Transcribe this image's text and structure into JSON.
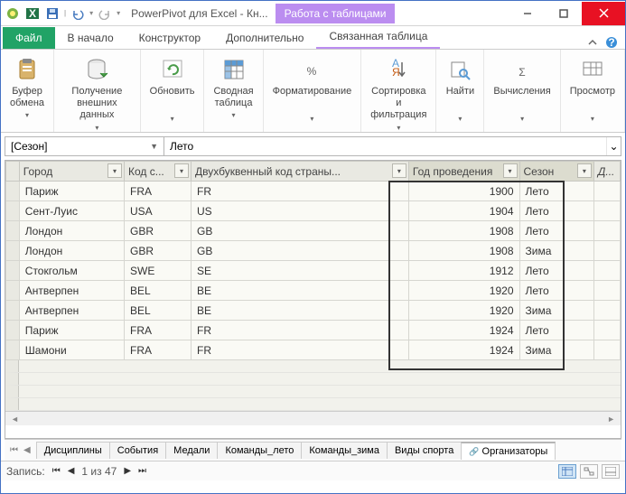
{
  "titlebar": {
    "app_title": "PowerPivot для Excel - Кн...",
    "context_tab": "Работа с таблицами"
  },
  "tabs": {
    "file": "Файл",
    "home": "В начало",
    "design": "Конструктор",
    "advanced": "Дополнительно",
    "linked": "Связанная таблица"
  },
  "ribbon": {
    "clipboard": "Буфер\nобмена",
    "getdata": "Получение\nвнешних данных",
    "refresh": "Обновить",
    "pivot": "Сводная\nтаблица",
    "format": "Форматирование",
    "sort": "Сортировка и\nфильтрация",
    "find": "Найти",
    "calc": "Вычисления",
    "view": "Просмотр"
  },
  "formula_bar": {
    "name": "[Сезон]",
    "value": "Лето"
  },
  "columns": {
    "city": "Город",
    "code_c": "Код с...",
    "two_letter": "Двухбуквенный код страны...",
    "year": "Год проведения",
    "season": "Сезон",
    "add": "Д..."
  },
  "rows": [
    {
      "city": "Париж",
      "code": "FRA",
      "cc": "FR",
      "year": "1900",
      "season": "Лето"
    },
    {
      "city": "Сент-Луис",
      "code": "USA",
      "cc": "US",
      "year": "1904",
      "season": "Лето"
    },
    {
      "city": "Лондон",
      "code": "GBR",
      "cc": "GB",
      "year": "1908",
      "season": "Лето"
    },
    {
      "city": "Лондон",
      "code": "GBR",
      "cc": "GB",
      "year": "1908",
      "season": "Зима"
    },
    {
      "city": "Стокгольм",
      "code": "SWE",
      "cc": "SE",
      "year": "1912",
      "season": "Лето"
    },
    {
      "city": "Антверпен",
      "code": "BEL",
      "cc": "BE",
      "year": "1920",
      "season": "Лето"
    },
    {
      "city": "Антверпен",
      "code": "BEL",
      "cc": "BE",
      "year": "1920",
      "season": "Зима"
    },
    {
      "city": "Париж",
      "code": "FRA",
      "cc": "FR",
      "year": "1924",
      "season": "Лето"
    },
    {
      "city": "Шамони",
      "code": "FRA",
      "cc": "FR",
      "year": "1924",
      "season": "Зима"
    }
  ],
  "sheets": {
    "s1": "Дисциплины",
    "s2": "События",
    "s3": "Медали",
    "s4": "Команды_лето",
    "s5": "Команды_зима",
    "s6": "Виды спорта",
    "s7": "Организаторы"
  },
  "status": {
    "label": "Запись:",
    "pos": "1 из 47"
  }
}
